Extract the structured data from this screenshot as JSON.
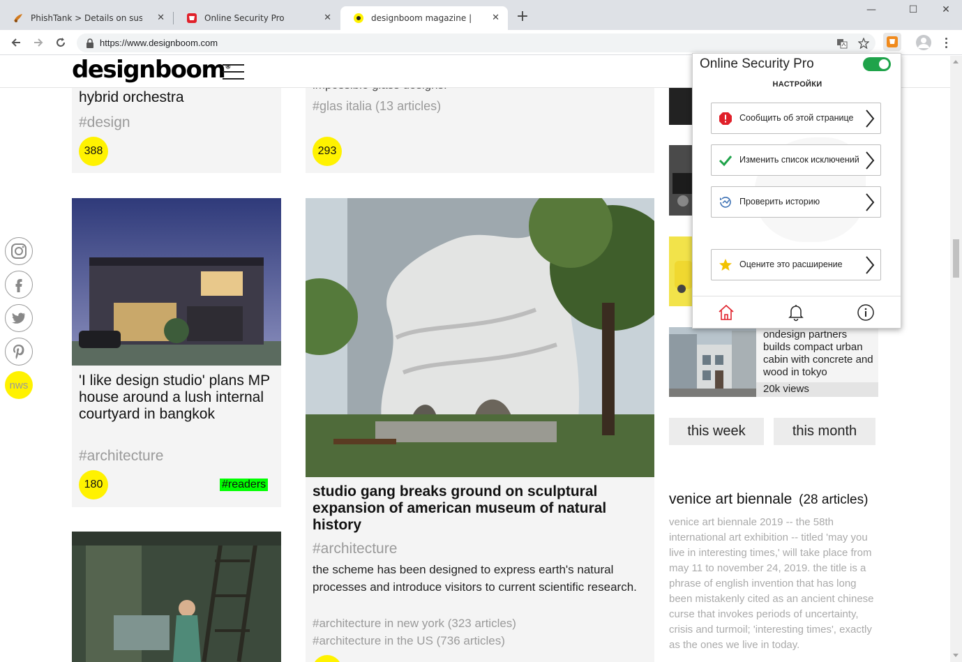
{
  "browser": {
    "tabs": [
      {
        "title": "PhishTank > Details on suspecte",
        "icon": "phishtank-icon"
      },
      {
        "title": "Online Security Pro",
        "icon": "online-security-icon"
      },
      {
        "title": "designboom magazine | your firs",
        "icon": "designboom-icon"
      }
    ],
    "url": "https://www.designboom.com",
    "window_controls": {
      "minimize": "—",
      "maximize": "☐",
      "close": "✕"
    },
    "tab_close": "✕",
    "new_tab": "+"
  },
  "site": {
    "logo": "designboom",
    "logo_mark": "®",
    "cards": {
      "top_left": {
        "title": "hybrid orchestra",
        "tag": "#design",
        "count": "388"
      },
      "top_mid": {
        "title_partial": "impossible glass designs.",
        "tag": "#glas italia (13 articles)",
        "count": "293"
      },
      "house": {
        "title": "'I like design studio' plans MP house around a lush internal courtyard in bangkok",
        "tag": "#architecture",
        "count": "180",
        "badge": "#readers"
      },
      "museum": {
        "title": "studio gang breaks ground on sculptural expansion of american museum of natural history",
        "tag": "#architecture",
        "description": "the scheme has been designed to express earth's natural processes and introduce visitors to current scientific research.",
        "related": [
          "#architecture in new york (323 articles)",
          "#architecture in the US (736 articles)"
        ]
      }
    },
    "sidebar": {
      "tokyo": {
        "text": "ondesign partners builds compact urban cabin with concrete and wood in tokyo",
        "views": "20k views"
      },
      "periods": [
        "this week",
        "this month"
      ],
      "biennale": {
        "title": "venice art biennale",
        "count": "(28 articles)",
        "body": "venice art biennale 2019 -- the 58th international art exhibition -- titled 'may you live in interesting times,' will take place from may 11 to november 24, 2019. the title is a phrase of english invention that has long been mistakenly cited as an ancient chinese curse that invokes periods of uncertainty, crisis and turmoil; 'interesting times', exactly as the ones we live in today."
      }
    },
    "social": [
      "instagram-icon",
      "facebook-icon",
      "twitter-icon",
      "pinterest-icon"
    ],
    "nws": "nws"
  },
  "popup": {
    "title": "Online Security Pro",
    "enabled": true,
    "settings_label": "НАСТРОЙКИ",
    "items": [
      {
        "label": "Сообщить об этой странице",
        "icon": "alert-icon"
      },
      {
        "label": "Изменить список исключений",
        "icon": "checkmark-icon"
      },
      {
        "label": "Проверить историю",
        "icon": "history-icon"
      },
      {
        "label": "Оцените это расширение",
        "icon": "star-icon"
      }
    ],
    "footer": [
      "home-icon",
      "bell-icon",
      "info-icon"
    ],
    "colors": {
      "toggle": "#1fa34a",
      "alert": "#e0202a",
      "check": "#1fa34a",
      "star": "#f2c200",
      "home": "#e0202a"
    }
  },
  "colors": {
    "count_badge": "#fff200",
    "readers_badge": "#00ff00"
  }
}
